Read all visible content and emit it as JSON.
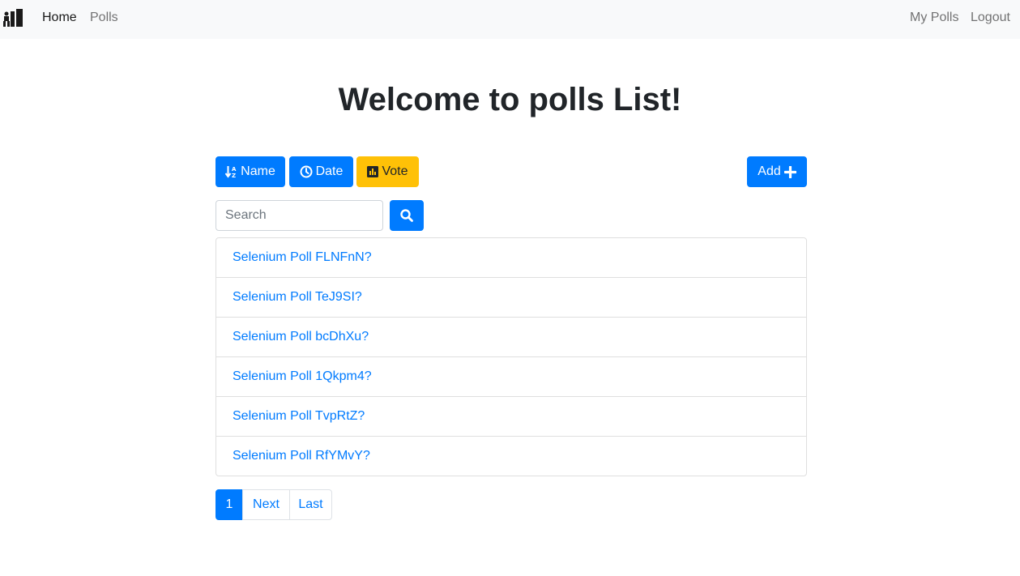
{
  "navbar": {
    "brand_icon": "polls-logo-icon",
    "links": [
      {
        "label": "Home",
        "active": true
      },
      {
        "label": "Polls",
        "active": false
      }
    ],
    "right_links": [
      {
        "label": "My Polls"
      },
      {
        "label": "Logout"
      }
    ]
  },
  "page": {
    "title": "Welcome to polls List!"
  },
  "sort_buttons": [
    {
      "label": "Name",
      "icon": "sort-alpha-icon",
      "color": "#007bff"
    },
    {
      "label": "Date",
      "icon": "clock-icon",
      "color": "#007bff"
    },
    {
      "label": "Vote",
      "icon": "bar-chart-icon",
      "color": "#ffc107"
    }
  ],
  "add_button": {
    "label": "Add",
    "icon": "plus-icon",
    "color": "#007bff"
  },
  "search": {
    "placeholder": "Search",
    "value": "",
    "button_icon": "search-icon"
  },
  "polls": [
    "Selenium Poll FLNFnN?",
    "Selenium Poll TeJ9SI?",
    "Selenium Poll bcDhXu?",
    "Selenium Poll 1Qkpm4?",
    "Selenium Poll TvpRtZ?",
    "Selenium Poll RfYMvY?"
  ],
  "pagination": {
    "current": "1",
    "next": "Next",
    "last": "Last"
  }
}
